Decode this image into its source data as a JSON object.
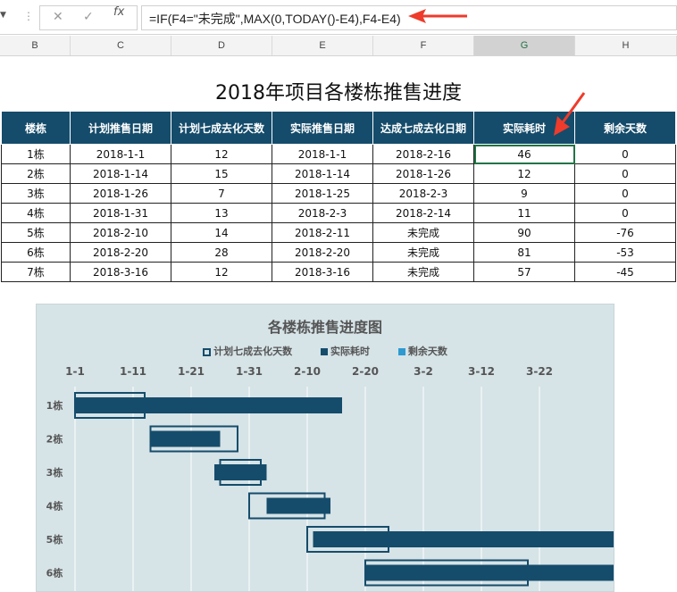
{
  "formula_bar": {
    "formula": "=IF(F4=\"未完成\",MAX(0,TODAY()-E4),F4-E4)",
    "cancel_icon": "x-icon",
    "confirm_icon": "check-icon",
    "fx_label": "fx"
  },
  "columns": [
    {
      "letter": "B",
      "selected": false
    },
    {
      "letter": "C",
      "selected": false
    },
    {
      "letter": "D",
      "selected": false
    },
    {
      "letter": "E",
      "selected": false
    },
    {
      "letter": "F",
      "selected": false
    },
    {
      "letter": "G",
      "selected": true
    },
    {
      "letter": "H",
      "selected": false
    }
  ],
  "sheet_title": "2018年项目各楼栋推售进度",
  "table": {
    "headers": [
      "楼栋",
      "计划推售日期",
      "计划七成去化天数",
      "实际推售日期",
      "达成七成去化日期",
      "实际耗时",
      "剩余天数"
    ],
    "rows": [
      [
        "1栋",
        "2018-1-1",
        "12",
        "2018-1-1",
        "2018-2-16",
        "46",
        "0"
      ],
      [
        "2栋",
        "2018-1-14",
        "15",
        "2018-1-14",
        "2018-1-26",
        "12",
        "0"
      ],
      [
        "3栋",
        "2018-1-26",
        "7",
        "2018-1-25",
        "2018-2-3",
        "9",
        "0"
      ],
      [
        "4栋",
        "2018-1-31",
        "13",
        "2018-2-3",
        "2018-2-14",
        "11",
        "0"
      ],
      [
        "5栋",
        "2018-2-10",
        "14",
        "2018-2-11",
        "未完成",
        "90",
        "-76"
      ],
      [
        "6栋",
        "2018-2-20",
        "28",
        "2018-2-20",
        "未完成",
        "81",
        "-53"
      ],
      [
        "7栋",
        "2018-3-16",
        "12",
        "2018-3-16",
        "未完成",
        "57",
        "-45"
      ]
    ]
  },
  "chart_data": {
    "type": "bar",
    "title": "各楼栋推售进度图",
    "orientation": "horizontal",
    "x_tick_labels": [
      "1-1",
      "1-11",
      "1-21",
      "1-31",
      "2-10",
      "2-20",
      "3-2",
      "3-12",
      "3-22"
    ],
    "x_tick_days": [
      0,
      10,
      20,
      30,
      40,
      50,
      60,
      70,
      80
    ],
    "x_axis_position": "top",
    "categories": [
      "1栋",
      "2栋",
      "3栋",
      "4栋",
      "5栋",
      "6栋"
    ],
    "series": [
      {
        "name": "计划七成去化天数",
        "start_day": [
          0,
          13,
          25,
          30,
          40,
          50
        ],
        "values": [
          12,
          15,
          7,
          13,
          14,
          28
        ],
        "color": "#154c6b",
        "style": "outline"
      },
      {
        "name": "实际耗时",
        "start_day": [
          0,
          13,
          24,
          33,
          41,
          50
        ],
        "values": [
          46,
          12,
          9,
          11,
          90,
          81
        ],
        "color": "#154c6b",
        "style": "filled"
      },
      {
        "name": "剩余天数",
        "values": [
          0,
          0,
          0,
          0,
          -76,
          -53
        ],
        "color": "#2e9ad0",
        "style": "filled"
      }
    ],
    "legend_position": "top",
    "grid": "vertical",
    "background": "#d6e3e7"
  }
}
